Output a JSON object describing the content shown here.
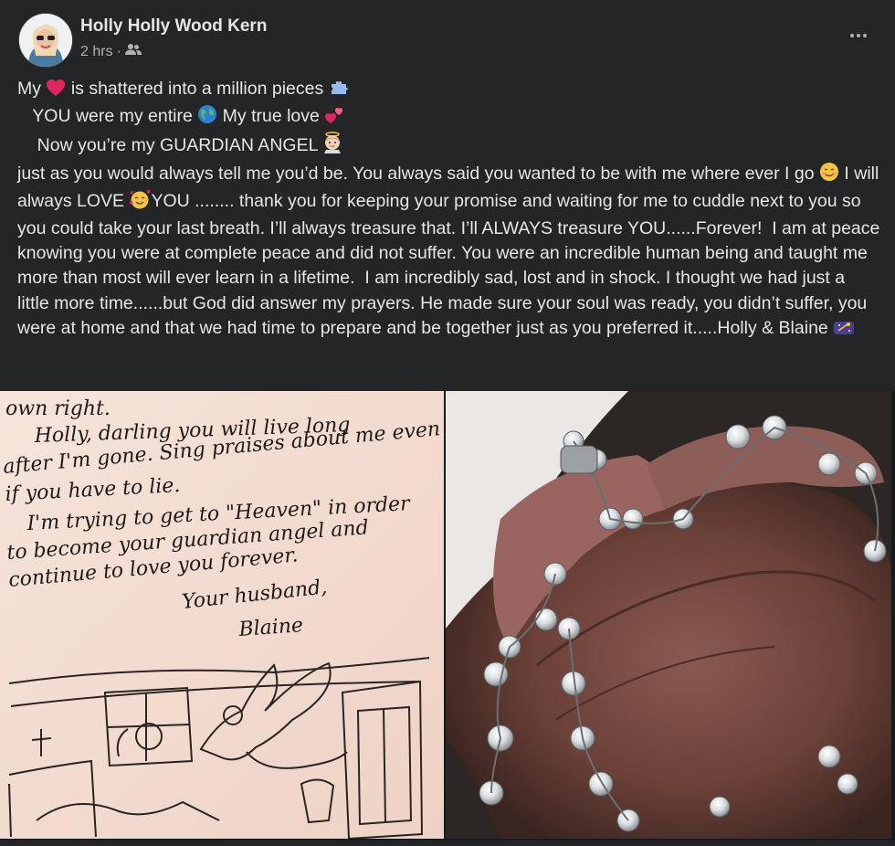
{
  "post": {
    "author": "Holly Holly Wood Kern",
    "time": "2 hrs",
    "separator": "·",
    "audience_icon": "friends-icon",
    "more_icon": "more-options-icon"
  },
  "text": {
    "line1_a": "My ",
    "line1_b": " is shattered into a million pieces ",
    "line2_a": "   YOU were my entire ",
    "line2_b": " My true love ",
    "line3_a": "    Now you’re my GUARDIAN ANGEL ",
    "body_a": "just as you would always tell me you’d be. You always said you wanted to be with me where ever I go ",
    "body_b": " I will always LOVE ",
    "body_c": "YOU ........ thank you for keeping your promise and waiting for me to cuddle next to you so you could take your last breath. I’ll always treasure that. I’ll ALWAYS treasure YOU......Forever!  I am at peace knowing you were at complete peace and did not suffer. You were an incredible human being and taught me more than most will ever learn in a lifetime.  I am incredibly sad, lost and in shock. I thought we had just a little more time......but God did answer my prayers. He made sure your soul was ready, you didn’t suffer, you were at home and that we had time to prepare and be together just as you preferred it.....Holly & Blaine "
  },
  "letter": {
    "l1": "own right.",
    "l2": "Holly, darling you will live long",
    "l3": "after I'm gone. Sing praises about me even",
    "l4": "if you have to lie.",
    "l5": "I'm trying to get to \"Heaven\" in order",
    "l6": "to become your guardian angel and",
    "l7": "continue to love you forever.",
    "l8": "Your husband,",
    "l9": "Blaine"
  },
  "colors": {
    "bg": "#242526",
    "text": "#e4e6eb",
    "muted": "#b0b3b8",
    "heart": "#e0245e"
  }
}
